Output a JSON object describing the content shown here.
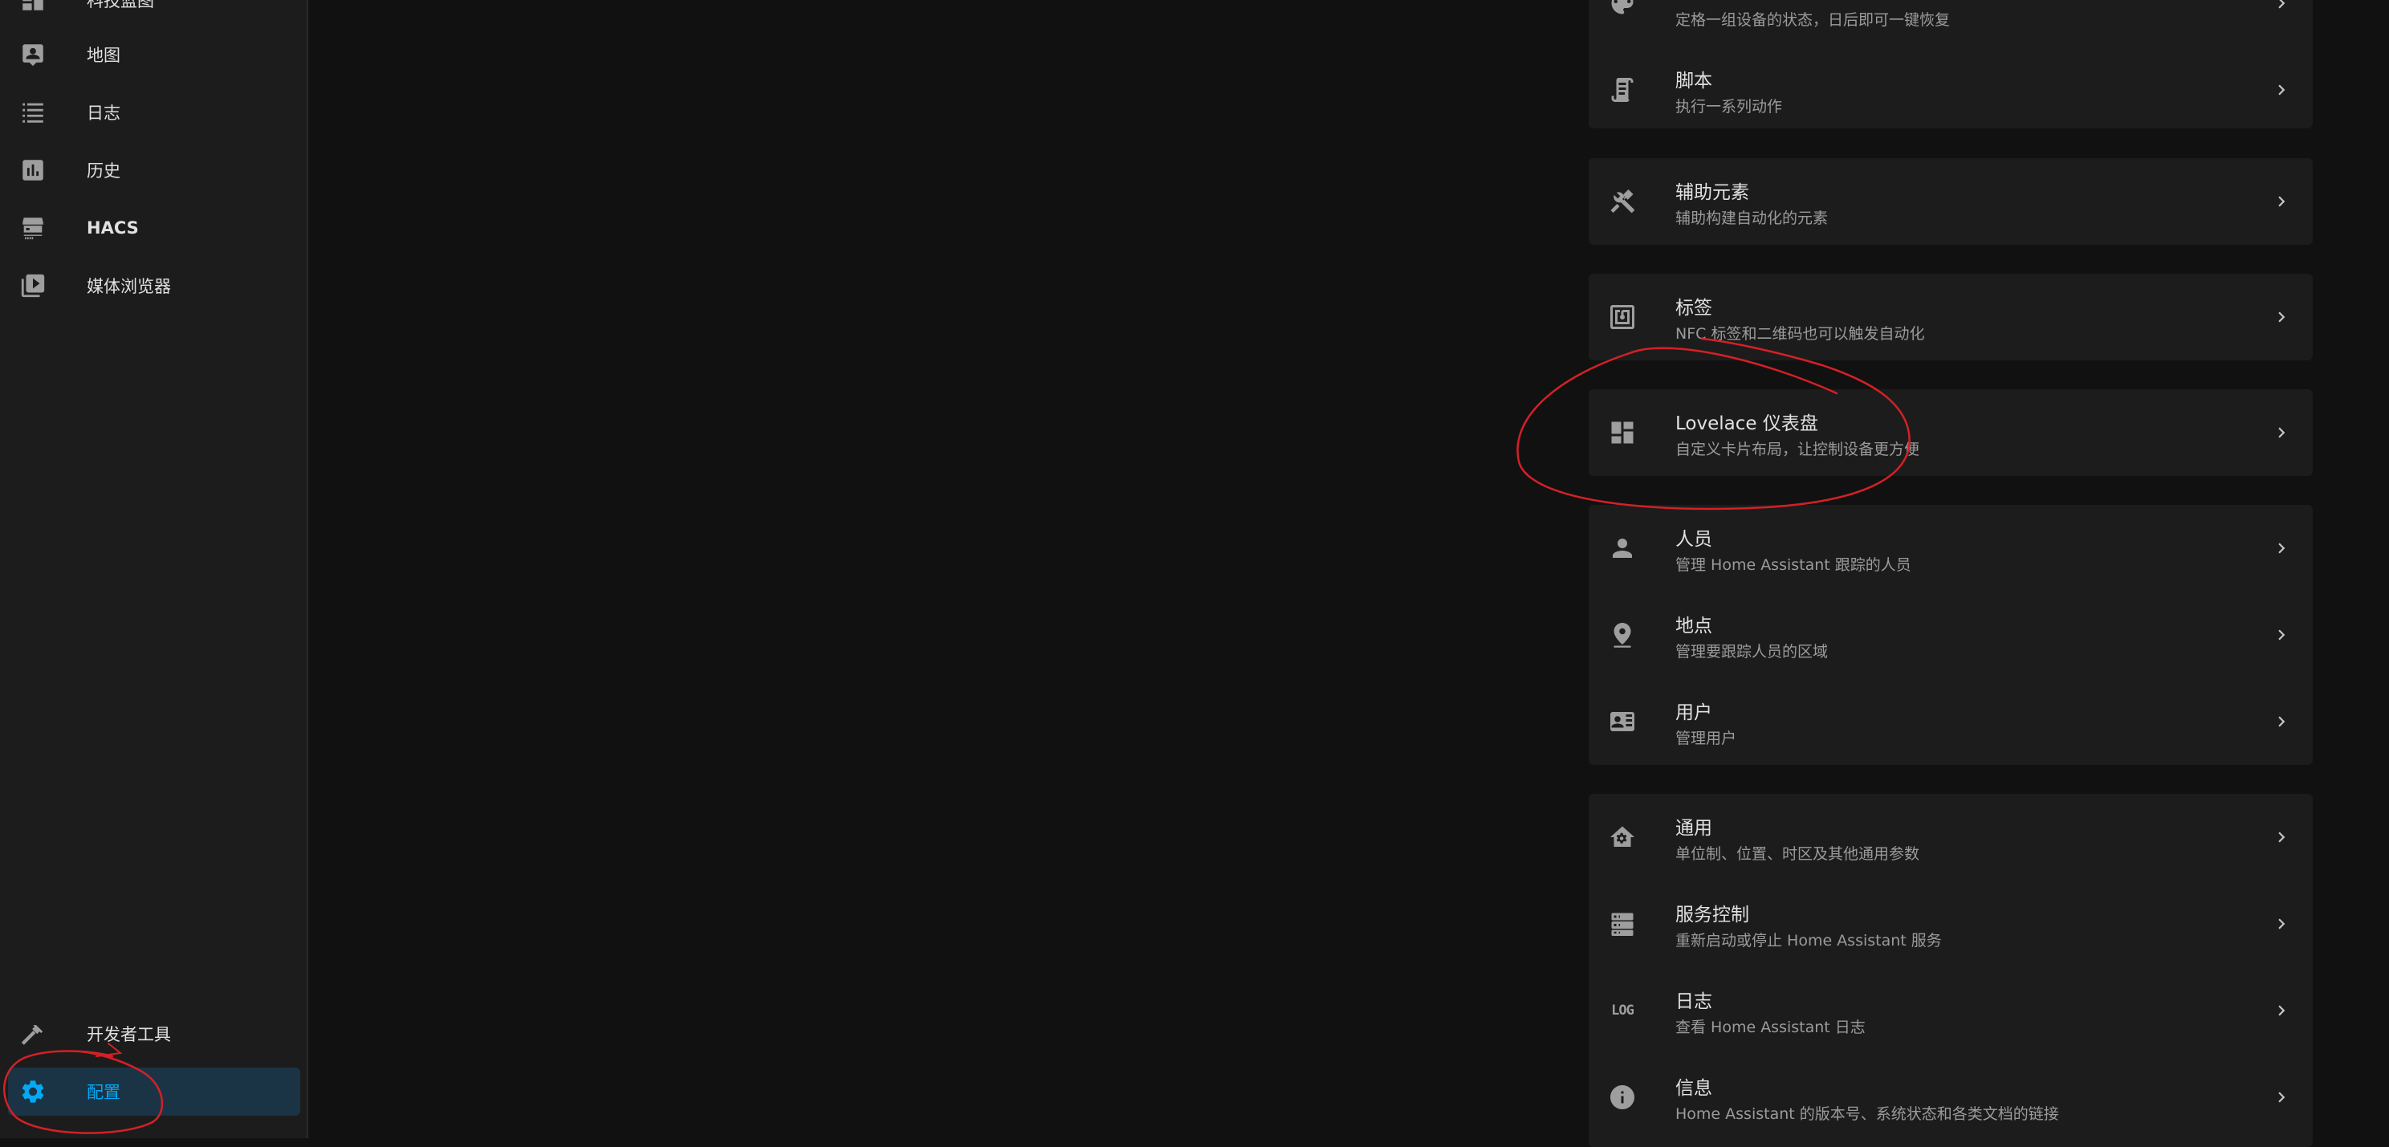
{
  "sidebar": {
    "items": [
      {
        "label": "科技蓝图",
        "icon": "dashboard-icon"
      },
      {
        "label": "地图",
        "icon": "map-person-icon"
      },
      {
        "label": "日志",
        "icon": "list-icon"
      },
      {
        "label": "历史",
        "icon": "chart-icon"
      },
      {
        "label": "HACS",
        "icon": "hacs-icon"
      },
      {
        "label": "媒体浏览器",
        "icon": "play-box-icon"
      }
    ],
    "bottom": [
      {
        "label": "开发者工具",
        "icon": "hammer-icon"
      },
      {
        "label": "配置",
        "icon": "gear-icon",
        "active": true
      }
    ]
  },
  "cards": [
    {
      "rows": [
        {
          "title": "",
          "subtitle": "定格一组设备的状态，日后即可一键恢复",
          "icon": "palette-icon"
        },
        {
          "title": "脚本",
          "subtitle": "执行一系列动作",
          "icon": "script-icon"
        }
      ]
    },
    {
      "rows": [
        {
          "title": "辅助元素",
          "subtitle": "辅助构建自动化的元素",
          "icon": "tools-icon"
        }
      ]
    },
    {
      "rows": [
        {
          "title": "标签",
          "subtitle": "NFC 标签和二维码也可以触发自动化",
          "icon": "nfc-icon"
        }
      ]
    },
    {
      "rows": [
        {
          "title": "Lovelace 仪表盘",
          "subtitle": "自定义卡片布局，让控制设备更方便",
          "icon": "dashboard-icon"
        }
      ]
    },
    {
      "rows": [
        {
          "title": "人员",
          "subtitle": "管理 Home Assistant 跟踪的人员",
          "icon": "person-icon"
        },
        {
          "title": "地点",
          "subtitle": "管理要跟踪人员的区域",
          "icon": "map-marker-icon"
        },
        {
          "title": "用户",
          "subtitle": "管理用户",
          "icon": "account-card-icon"
        }
      ]
    },
    {
      "rows": [
        {
          "title": "通用",
          "subtitle": "单位制、位置、时区及其他通用参数",
          "icon": "home-gear-icon"
        },
        {
          "title": "服务控制",
          "subtitle": "重新启动或停止 Home Assistant 服务",
          "icon": "server-icon"
        },
        {
          "title": "日志",
          "subtitle": "查看 Home Assistant 日志",
          "icon": "log-icon",
          "icon_text": "LOG"
        },
        {
          "title": "信息",
          "subtitle": "Home Assistant 的版本号、系统状态和各类文档的链接",
          "icon": "info-icon"
        }
      ]
    }
  ],
  "colors": {
    "background": "#111111",
    "sidebar": "#1c1c1c",
    "card": "#1c1c1c",
    "accent": "#03a9f4",
    "active_bg": "#1a3446",
    "annotation": "#d42027"
  }
}
